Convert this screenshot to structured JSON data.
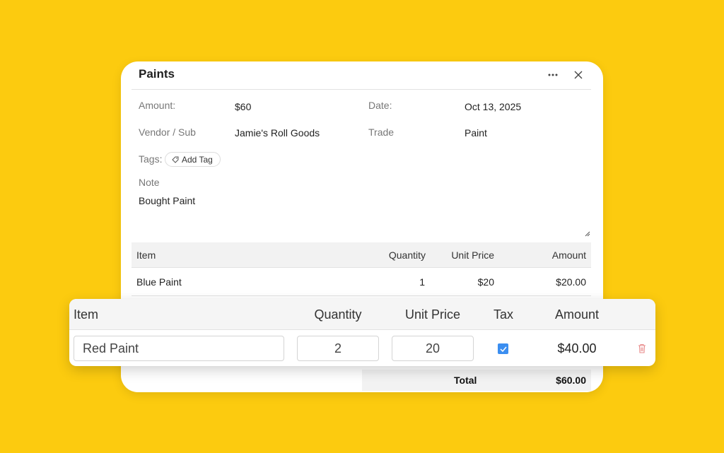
{
  "dialog": {
    "title": "Paints",
    "fields": {
      "amount_label": "Amount:",
      "amount_value": "$60",
      "date_label": "Date:",
      "date_value": "Oct 13, 2025",
      "vendor_label": "Vendor / Sub",
      "vendor_value": "Jamie's Roll Goods",
      "trade_label": "Trade",
      "trade_value": "Paint",
      "tags_label": "Tags:",
      "add_tag_label": "Add Tag",
      "note_label": "Note",
      "note_value": "Bought Paint"
    },
    "table": {
      "headers": {
        "item": "Item",
        "quantity": "Quantity",
        "unit_price": "Unit Price",
        "amount": "Amount"
      },
      "rows": [
        {
          "item": "Blue Paint",
          "quantity": "1",
          "unit_price": "$20",
          "amount": "$20.00"
        }
      ],
      "total_label": "Total",
      "total_value": "$60.00"
    }
  },
  "edit_row": {
    "headers": {
      "item": "Item",
      "quantity": "Quantity",
      "unit_price": "Unit Price",
      "tax": "Tax",
      "amount": "Amount"
    },
    "item_value": "Red Paint",
    "quantity_value": "2",
    "unit_price_value": "20",
    "tax_checked": true,
    "amount_value": "$40.00"
  },
  "colors": {
    "background": "#FCCB0F",
    "checkbox": "#3b8ef0",
    "delete_icon": "#e88a8a"
  },
  "icons": [
    "more-icon",
    "close-icon",
    "tag-icon",
    "resize-handle-icon",
    "check-icon",
    "trash-icon"
  ]
}
